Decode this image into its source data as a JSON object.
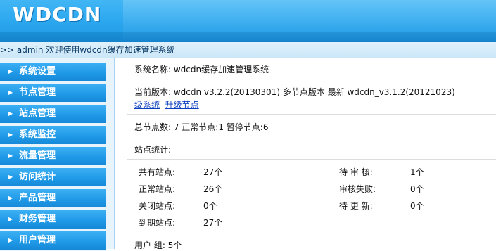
{
  "header": {
    "logo": "WDCDN"
  },
  "welcome": {
    "text": ">> admin 欢迎使用wdcdn缓存加速管理系统"
  },
  "sidebar": {
    "items": [
      {
        "label": "系统设置"
      },
      {
        "label": "节点管理"
      },
      {
        "label": "站点管理"
      },
      {
        "label": "系统监控"
      },
      {
        "label": "流量管理"
      },
      {
        "label": "访问统计"
      },
      {
        "label": "产品管理"
      },
      {
        "label": "财务管理"
      },
      {
        "label": "用户管理"
      }
    ]
  },
  "main": {
    "system_name": "系统名称: wdcdn缓存加速管理系统",
    "version": "当前版本: wdcdn v3.2.2(20130301) 多节点版本 最新 wdcdn_v3.1.2(20121023)",
    "upgrade_system_link": "级系统",
    "upgrade_node_link": "升级节点",
    "nodes": "总节点数: 7  正常节点:1  暂停节点:6",
    "site_stats_title": "站点统计:",
    "site_stats": {
      "total_label": "共有站点:",
      "total_value": "27个",
      "normal_label": "正常站点:",
      "normal_value": "26个",
      "closed_label": "关闭站点:",
      "closed_value": "0个",
      "expired_label": "到期站点:",
      "expired_value": "27个",
      "pending_review_label": "待 审 核:",
      "pending_review_value": "1个",
      "review_failed_label": "审核失败:",
      "review_failed_value": "0个",
      "pending_update_label": "待 更 新:",
      "pending_update_value": "0个"
    },
    "user_group": "用户 组:  5个"
  }
}
